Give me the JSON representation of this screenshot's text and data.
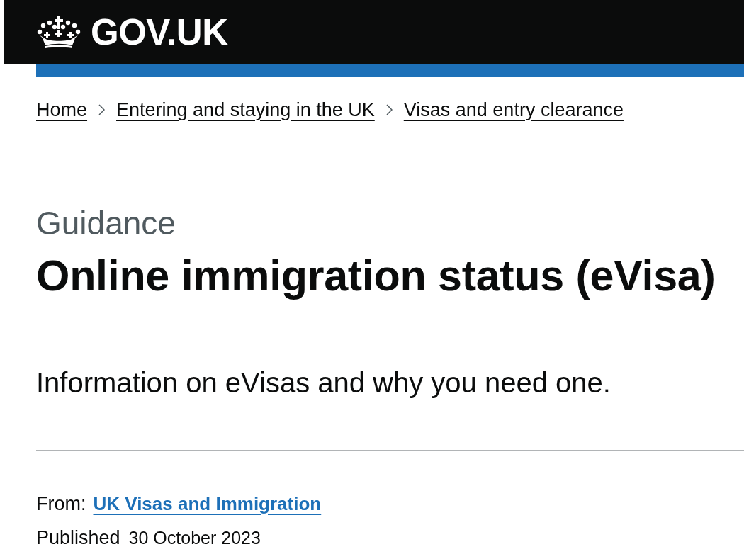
{
  "header": {
    "logo_text": "GOV.UK"
  },
  "breadcrumbs": [
    {
      "label": "Home"
    },
    {
      "label": "Entering and staying in the UK"
    },
    {
      "label": "Visas and entry clearance"
    }
  ],
  "caption": "Guidance",
  "title": "Online immigration status (eVisa)",
  "lead": "Information on eVisas and why you need one.",
  "metadata": {
    "from_label": "From:",
    "from_link": "UK Visas and Immigration",
    "published_label": "Published",
    "published_date": "30 October 2023"
  }
}
